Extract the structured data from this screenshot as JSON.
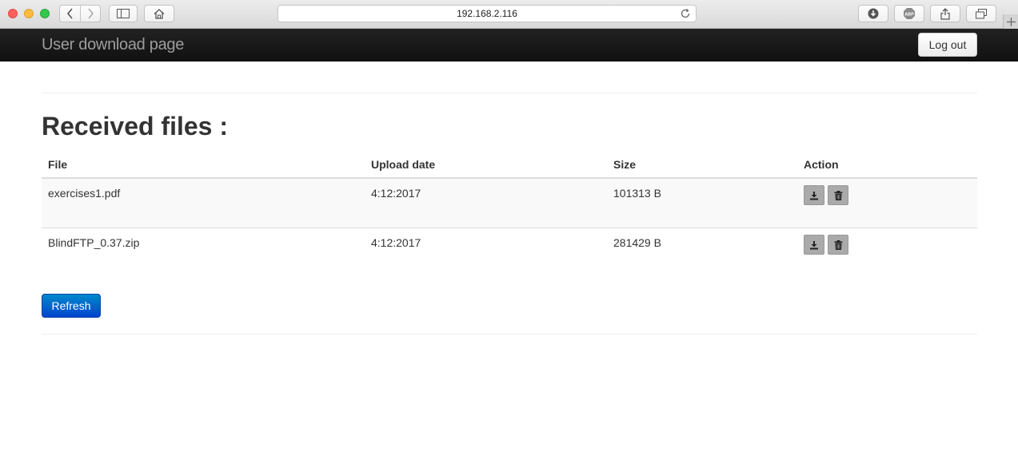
{
  "browser": {
    "address": "192.168.2.116"
  },
  "navbar": {
    "brand": "User download page",
    "logout_label": "Log out"
  },
  "main": {
    "title": "Received files :",
    "table": {
      "headers": [
        "File",
        "Upload date",
        "Size",
        "Action"
      ],
      "rows": [
        {
          "file": "exercises1.pdf",
          "date": "4:12:2017",
          "size": "101313 B"
        },
        {
          "file": "BlindFTP_0.37.zip",
          "date": "4:12:2017",
          "size": "281429 B"
        }
      ]
    },
    "refresh_label": "Refresh"
  },
  "colors": {
    "navbar_bg": "#1b1b1b",
    "brand_text": "#9d9d9d",
    "refresh_bg": "#0064cd",
    "action_bg": "#aaaaaa"
  },
  "icons": {
    "download": "download-icon",
    "delete": "trash-icon"
  }
}
